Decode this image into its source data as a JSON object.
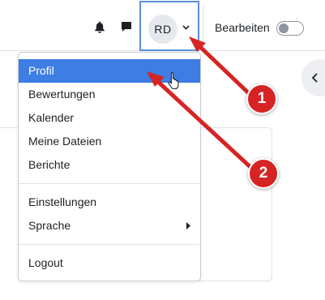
{
  "navbar": {
    "icons": [
      "bell-icon",
      "chat-icon",
      "chevron-down-icon"
    ],
    "user_initials": "RD",
    "edit_mode_label": "Bearbeiten",
    "edit_mode_on": false
  },
  "user_menu": {
    "items": [
      {
        "label": "Profil",
        "active": true
      },
      {
        "label": "Bewertungen"
      },
      {
        "label": "Kalender"
      },
      {
        "label": "Meine Dateien"
      },
      {
        "label": "Berichte"
      },
      {
        "label": "Einstellungen"
      },
      {
        "label": "Sprache",
        "has_submenu": true
      },
      {
        "label": "Logout"
      }
    ]
  },
  "annotations": {
    "badge_1": "1",
    "badge_2": "2",
    "color": "#d62424"
  },
  "colors": {
    "active_item": "#3d7de4",
    "highlight_border": "#5a8fd8"
  }
}
